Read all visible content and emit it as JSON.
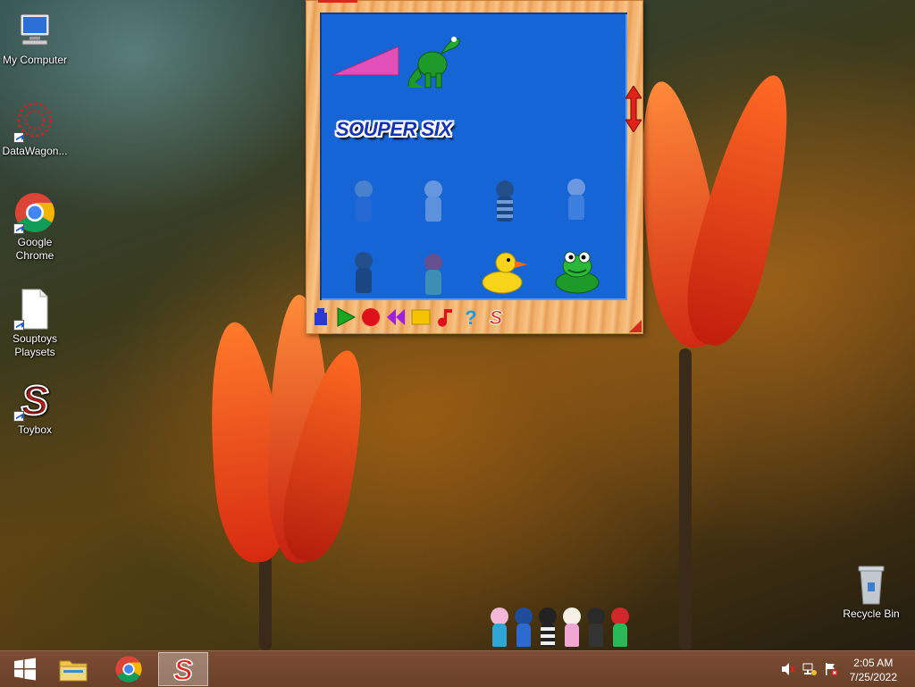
{
  "desktop": {
    "icons": [
      {
        "label": "My Computer"
      },
      {
        "label": "DataWagon..."
      },
      {
        "label": "Google Chrome"
      },
      {
        "label": "Souptoys Playsets"
      },
      {
        "label": "Toybox"
      },
      {
        "label": "Recycle Bin"
      }
    ]
  },
  "app_window": {
    "scene_title": "SOUPER SIX",
    "toolbar_icons": [
      "build-icon",
      "play-icon",
      "record-icon",
      "rewind-icon",
      "stop-icon",
      "music-icon",
      "help-icon",
      "souptoys-logo-icon"
    ]
  },
  "taskbar": {
    "pinned": [
      "start-button",
      "file-explorer",
      "google-chrome",
      "souptoys"
    ],
    "time": "2:05 AM",
    "date": "7/25/2022"
  },
  "colors": {
    "stage_blue": "#1565d6",
    "frame_wood": "#f4b16a",
    "accent_red": "#d62a1a",
    "taskbar": "#6a4029"
  }
}
